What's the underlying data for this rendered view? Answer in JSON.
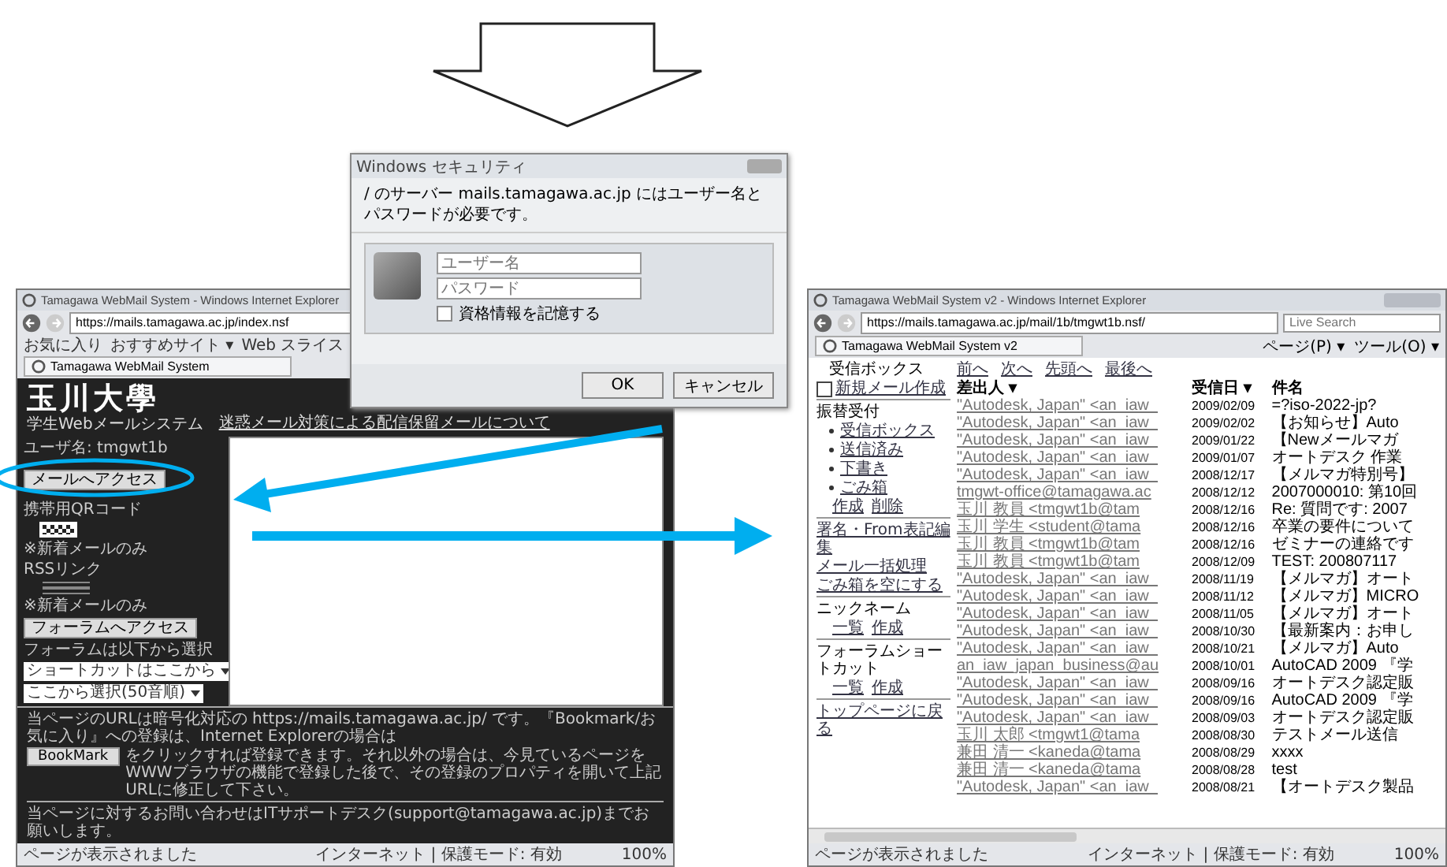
{
  "left_window": {
    "title": "Tamagawa WebMail System - Windows Internet Explorer",
    "address": "https://mails.tamagawa.ac.jp/index.nsf",
    "favorites": [
      "お気に入り",
      "おすすめサイト ▾",
      "Web スライス"
    ],
    "tab": "Tamagawa WebMail System",
    "page": {
      "logo": "玉川大學",
      "subtitle": "学生Webメールシステム",
      "header_link": "迷惑メール対策による配信保留メールについて",
      "sidebar": [
        {
          "kind": "text",
          "text": "ユーザ名: tmgwt1b"
        },
        {
          "kind": "button",
          "text": "メールへアクセス"
        },
        {
          "kind": "text",
          "text": "携帯用QRコード"
        },
        {
          "kind": "qr"
        },
        {
          "kind": "text",
          "text": "※新着メールのみ"
        },
        {
          "kind": "text",
          "text": "RSSリンク"
        },
        {
          "kind": "badge"
        },
        {
          "kind": "badge"
        },
        {
          "kind": "badge"
        },
        {
          "kind": "text",
          "text": "※新着メールのみ"
        },
        {
          "kind": "button",
          "text": "フォーラムへアクセス"
        },
        {
          "kind": "text",
          "text": "フォーラムは以下から選択"
        },
        {
          "kind": "select",
          "text": "ショートカットはここから"
        },
        {
          "kind": "select",
          "text": "ここから選択(50音順)"
        }
      ],
      "footer_before": "当ページのURLは暗号化対応の https://mails.tamagawa.ac.jp/ です。『Bookmark/お気に入り』への登録は、Internet Explorerの場合は",
      "footer_button": "BookMark",
      "footer_after": "をクリックすれば登録できます。それ以外の場合は、今見ているページをWWWブラウザの機能で登録した後で、その登録のプロパティを開いて上記URLに修正して下さい。",
      "footer_contact": "当ページに対するお問い合わせはITサポートデスク(support@tamagawa.ac.jp)までお願いします。"
    },
    "status": "ページが表示されました",
    "zone": "インターネット | 保護モード: 有効",
    "zoom": "100%"
  },
  "dialog": {
    "title": "Windows セキュリティ",
    "message": "/ のサーバー mails.tamagawa.ac.jp にはユーザー名とパスワードが必要です。",
    "username": {
      "placeholder": "ユーザー名"
    },
    "password": {
      "placeholder": "パスワード"
    },
    "remember": {
      "label": "資格情報を記憶する",
      "checked": false
    },
    "buttons": [
      "OK",
      "キャンセル"
    ]
  },
  "right_window": {
    "title": "Tamagawa WebMail System v2 - Windows Internet Explorer",
    "address": "https://mails.tamagawa.ac.jp/mail/1b/tmgwt1b.nsf/",
    "search": {
      "placeholder": "Live Search"
    },
    "tab": "Tamagawa WebMail System v2",
    "tools": [
      "ページ(P) ▾",
      "ツール(O) ▾"
    ],
    "sidebar": {
      "heading": "受信ボックス",
      "compose": "新規メール作成",
      "section": "振替受付",
      "folders": [
        "受信ボックス",
        "送信済み",
        "下書き",
        "ごみ箱"
      ],
      "actions": [
        "作成",
        "削除"
      ],
      "links": [
        "署名・From表記編集",
        "メール一括処理",
        "ごみ箱を空にする"
      ],
      "groups": [
        {
          "title": "ニックネーム",
          "items": [
            "一覧",
            "作成"
          ]
        },
        {
          "title": "フォーラムショートカット",
          "items": [
            "一覧",
            "作成"
          ]
        }
      ],
      "back": "トップページに戻る"
    },
    "nav": [
      "前へ",
      "次へ",
      "先頭へ",
      "最後へ"
    ],
    "columns": [
      "差出人 ▾",
      "受信日 ▾",
      "件名"
    ],
    "rows": [
      {
        "sender": "\"Autodesk, Japan\" <an_iaw_",
        "date": "2009/02/09",
        "subject": "=?iso-2022-jp?"
      },
      {
        "sender": "\"Autodesk, Japan\" <an_iaw_",
        "date": "2009/02/02",
        "subject": "【お知らせ】Auto"
      },
      {
        "sender": "\"Autodesk, Japan\" <an_iaw_",
        "date": "2009/01/22",
        "subject": "【Newメールマガ"
      },
      {
        "sender": "\"Autodesk, Japan\" <an_iaw_",
        "date": "2009/01/07",
        "subject": "オートデスク 作業"
      },
      {
        "sender": "\"Autodesk, Japan\" <an_iaw_",
        "date": "2008/12/17",
        "subject": "【メルマガ特別号】"
      },
      {
        "sender": "tmgwt-office@tamagawa.ac",
        "date": "2008/12/12",
        "subject": "2007000010: 第10回"
      },
      {
        "sender": "玉川 教員 <tmgwt1b@tam",
        "date": "2008/12/16",
        "subject": "Re: 質問です: 2007"
      },
      {
        "sender": "玉川 学生 <student@tama",
        "date": "2008/12/16",
        "subject": "卒業の要件について"
      },
      {
        "sender": "玉川 教員 <tmgwt1b@tam",
        "date": "2008/12/16",
        "subject": "ゼミナーの連絡です"
      },
      {
        "sender": "玉川 教員 <tmgwt1b@tam",
        "date": "2008/12/09",
        "subject": "TEST: 200807117"
      },
      {
        "sender": "\"Autodesk, Japan\" <an_iaw_",
        "date": "2008/11/19",
        "subject": "【メルマガ】オート"
      },
      {
        "sender": "\"Autodesk, Japan\" <an_iaw_",
        "date": "2008/11/12",
        "subject": "【メルマガ】MICRO"
      },
      {
        "sender": "\"Autodesk, Japan\" <an_iaw_",
        "date": "2008/11/05",
        "subject": "【メルマガ】オート"
      },
      {
        "sender": "\"Autodesk, Japan\" <an_iaw_",
        "date": "2008/10/30",
        "subject": "【最新案内：お申し"
      },
      {
        "sender": "\"Autodesk, Japan\" <an_iaw_",
        "date": "2008/10/21",
        "subject": "【メルマガ】Auto"
      },
      {
        "sender": "an_iaw_japan_business@au",
        "date": "2008/10/01",
        "subject": "AutoCAD 2009 『学"
      },
      {
        "sender": "\"Autodesk, Japan\" <an_iaw_",
        "date": "2008/09/16",
        "subject": "オートデスク認定販"
      },
      {
        "sender": "\"Autodesk, Japan\" <an_iaw_",
        "date": "2008/09/16",
        "subject": "AutoCAD 2009 『学"
      },
      {
        "sender": "\"Autodesk, Japan\" <an_iaw_",
        "date": "2008/09/03",
        "subject": "オートデスク認定販"
      },
      {
        "sender": "玉川 太郎 <tmgwt1@tama",
        "date": "2008/08/30",
        "subject": "テストメール送信"
      },
      {
        "sender": "兼田 清一 <kaneda@tama",
        "date": "2008/08/29",
        "subject": "xxxx"
      },
      {
        "sender": "兼田 清一 <kaneda@tama",
        "date": "2008/08/28",
        "subject": "test"
      },
      {
        "sender": "\"Autodesk, Japan\" <an_iaw_",
        "date": "2008/08/21",
        "subject": "【オートデスク製品"
      }
    ],
    "status": "ページが表示されました",
    "zone": "インターネット | 保護モード: 有効",
    "zoom": "100%"
  }
}
